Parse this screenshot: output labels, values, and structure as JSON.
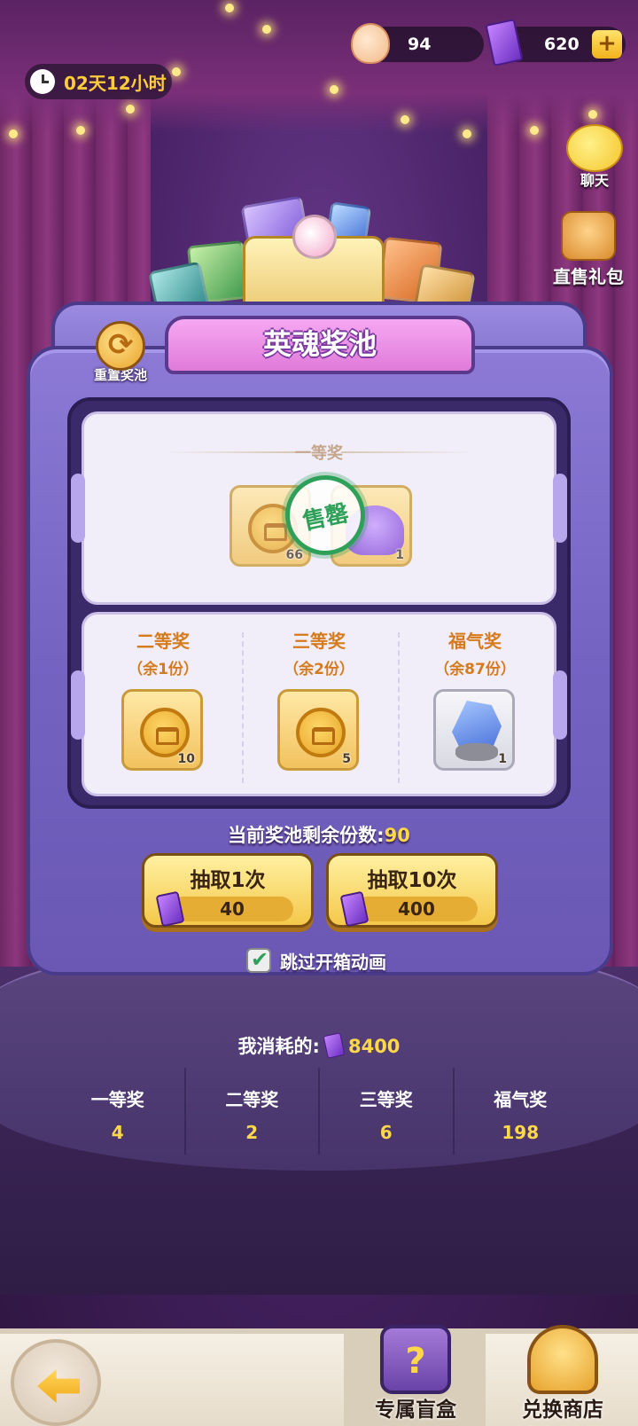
{
  "header": {
    "timer": "02天12小时",
    "shells": "94",
    "tickets": "620",
    "plus_label": "+"
  },
  "side": {
    "chat_label": "聊天",
    "gift_label": "直售礼包"
  },
  "pool": {
    "title": "英魂奖池",
    "reset_label": "重置奖池",
    "first_prize": {
      "title": "一等奖",
      "items": [
        {
          "icon": "coin-icon",
          "qty": "66"
        },
        {
          "icon": "ghost-hero-icon",
          "qty": "1"
        }
      ],
      "stamp": "售罄"
    },
    "tiers": [
      {
        "name": "二等奖",
        "left": "（余1份）",
        "icon": "coin-icon",
        "qty": "10"
      },
      {
        "name": "三等奖",
        "left": "（余2份）",
        "icon": "coin-icon",
        "qty": "5"
      },
      {
        "name": "福气奖",
        "left": "（余87份）",
        "icon": "crystal-icon",
        "qty": "1"
      }
    ],
    "remaining_label": "当前奖池剩余份数:",
    "remaining_value": "90",
    "draw_once": {
      "label": "抽取1次",
      "cost": "40"
    },
    "draw_ten": {
      "label": "抽取10次",
      "cost": "400"
    },
    "skip_label": "跳过开箱动画",
    "skip_checked": true
  },
  "consumed": {
    "label": "我消耗的:",
    "value": "8400"
  },
  "stats": [
    {
      "name": "一等奖",
      "value": "4"
    },
    {
      "name": "二等奖",
      "value": "2"
    },
    {
      "name": "三等奖",
      "value": "6"
    },
    {
      "name": "福气奖",
      "value": "198"
    }
  ],
  "nav": {
    "blind_box": "专属盲盒",
    "exchange_shop": "兑换商店"
  }
}
